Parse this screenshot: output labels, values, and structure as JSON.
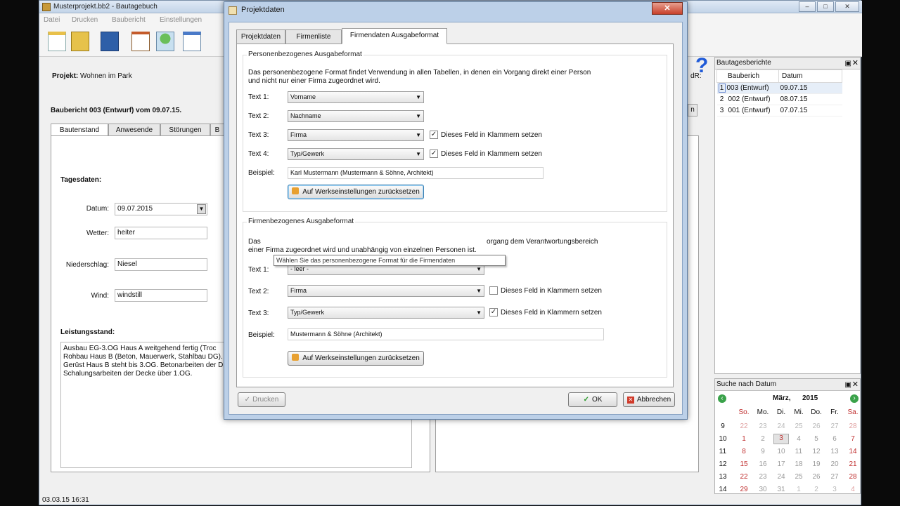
{
  "app": {
    "title": "Musterprojekt.bb2 - Bautagebuch",
    "menu": [
      "Datei",
      "Drucken",
      "Baubericht",
      "Einstellungen"
    ],
    "project_label": "Projekt:",
    "project_name": "Wohnen im Park",
    "report_heading": "Baubericht 003 (Entwurf) vom 09.07.15.",
    "left_tabs": [
      "Bautenstand",
      "Anwesende",
      "Störungen",
      "B"
    ],
    "tagesdaten_title": "Tagesdaten:",
    "fields": {
      "datum_label": "Datum:",
      "datum_value": "09.07.2015",
      "wetter_label": "Wetter:",
      "wetter_value": "heiter",
      "niederschlag_label": "Niederschlag:",
      "niederschlag_value": "Niesel",
      "wind_label": "Wind:",
      "wind_value": "windstill"
    },
    "leistungsstand_title": "Leistungsstand:",
    "leistungsstand_text": "Ausbau EG-3.OG Haus A weitgehend fertig (Troc\nRohbau Haus B (Beton, Mauerwerk, Stahlbau DG).\nGerüst Haus B steht bis 3.OG. Betonarbeiten der D\nSchalungsarbeiten der Decke über 1.OG.",
    "status": "03.03.15 16:31",
    "cut_label": "dR:",
    "cut_button": "n"
  },
  "reports_panel": {
    "title": "Bautagesberichte",
    "columns": [
      "Bauberich",
      "Datum"
    ],
    "rows": [
      {
        "n": "1",
        "name": "003 (Entwurf)",
        "date": "09.07.15"
      },
      {
        "n": "2",
        "name": "002 (Entwurf)",
        "date": "08.07.15"
      },
      {
        "n": "3",
        "name": "001 (Entwurf)",
        "date": "07.07.15"
      }
    ]
  },
  "calendar": {
    "title": "Suche nach Datum",
    "month": "März,",
    "year": "2015",
    "weekdays": [
      "So.",
      "Mo.",
      "Di.",
      "Mi.",
      "Do.",
      "Fr.",
      "Sa."
    ],
    "weeks": [
      {
        "kw": "9",
        "days": [
          "22",
          "23",
          "24",
          "25",
          "26",
          "27",
          "28"
        ]
      },
      {
        "kw": "10",
        "days": [
          "1",
          "2",
          "3",
          "4",
          "5",
          "6",
          "7"
        ]
      },
      {
        "kw": "11",
        "days": [
          "8",
          "9",
          "10",
          "11",
          "12",
          "13",
          "14"
        ]
      },
      {
        "kw": "12",
        "days": [
          "15",
          "16",
          "17",
          "18",
          "19",
          "20",
          "21"
        ]
      },
      {
        "kw": "13",
        "days": [
          "22",
          "23",
          "24",
          "25",
          "26",
          "27",
          "28"
        ]
      },
      {
        "kw": "14",
        "days": [
          "29",
          "30",
          "31",
          "1",
          "2",
          "3",
          "4"
        ]
      }
    ]
  },
  "dialog": {
    "title": "Projektdaten",
    "close": "✕",
    "tabs": [
      "Projektdaten",
      "Firmenliste",
      "Firmendaten Ausgabeformat"
    ],
    "person": {
      "title": "Personenbezogenes Ausgabeformat",
      "desc": "Das personenbezogene Format findet Verwendung in allen Tabellen, in denen ein Vorgang direkt einer Person\nund nicht nur einer Firma zugeordnet wird.",
      "text1_label": "Text 1:",
      "text1": "Vorname",
      "text2_label": "Text 2:",
      "text2": "Nachname",
      "text3_label": "Text 3:",
      "text3": "Firma",
      "text4_label": "Text 4:",
      "text4": "Typ/Gewerk",
      "klammer_label": "Dieses Feld in Klammern setzen",
      "example_label": "Beispiel:",
      "example": "Karl  Mustermann  (Mustermann & Söhne,  Architekt)",
      "reset": "Auf Werkseinstellungen zurücksetzen"
    },
    "firm": {
      "title": "Firmenbezogenes Ausgabeformat",
      "desc_a": "Das",
      "desc_b": "organg dem Verantwortungsbereich",
      "desc_c": "einer Firma zugeordnet wird und unabhängig von einzelnen Personen ist.",
      "text1_label": "Text 1:",
      "text1": "- leer -",
      "text2_label": "Text 2:",
      "text2": "Firma",
      "text3_label": "Text 3:",
      "text3": "Typ/Gewerk",
      "klammer_label": "Dieses Feld in Klammern setzen",
      "example_label": "Beispiel:",
      "example": "Mustermann & Söhne  (Architekt)",
      "reset": "Auf Werkseinstellungen zurücksetzen"
    },
    "tooltip": "Wählen Sie das personenbezogene Format für die Firmendaten",
    "print": "Drucken",
    "ok": "OK",
    "cancel": "Abbrechen"
  }
}
